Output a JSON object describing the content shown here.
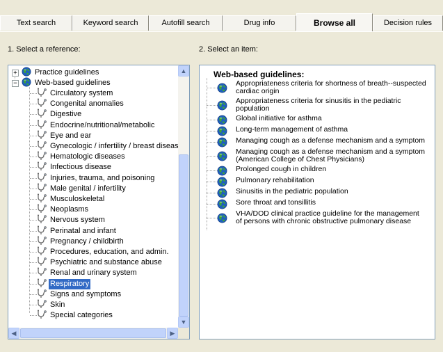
{
  "tabs": [
    {
      "label": "Text search",
      "active": false
    },
    {
      "label": "Keyword search",
      "active": false
    },
    {
      "label": "Autofill search",
      "active": false
    },
    {
      "label": "Drug info",
      "active": false
    },
    {
      "label": "Browse all",
      "active": true
    },
    {
      "label": "Decision rules",
      "active": false
    }
  ],
  "reference_label": "1. Select a reference:",
  "item_label": "2. Select an item:",
  "tree": {
    "practice": {
      "label": "Practice guidelines",
      "toggle": "+"
    },
    "web": {
      "label": "Web-based guidelines",
      "toggle": "−"
    },
    "children": [
      "Circulatory system",
      "Congenital anomalies",
      "Digestive",
      "Endocrine/nutritional/metabolic",
      "Eye and ear",
      "Gynecologic / infertility / breast disease",
      "Hematologic diseases",
      "Infectious disease",
      "Injuries, trauma, and poisoning",
      "Male genital / infertility",
      "Musculoskeletal",
      "Neoplasms",
      "Nervous system",
      "Perinatal and infant",
      "Pregnancy / childbirth",
      "Procedures, education, and admin.",
      "Psychiatric and substance abuse",
      "Renal and urinary system",
      "Respiratory",
      "Signs and symptoms",
      "Skin",
      "Special categories"
    ],
    "selected": "Respiratory"
  },
  "items": {
    "header": "Web-based guidelines:",
    "list": [
      {
        "lines": [
          "Appropriateness criteria for shortness of breath--suspected",
          "cardiac origin"
        ]
      },
      {
        "lines": [
          "Appropriateness criteria for sinusitis in the pediatric",
          "population"
        ]
      },
      {
        "lines": [
          "Global initiative for asthma"
        ]
      },
      {
        "lines": [
          "Long-term management of asthma"
        ]
      },
      {
        "lines": [
          "Managing cough as a defense mechanism and a symptom"
        ]
      },
      {
        "lines": [
          "Managing cough as a defense mechanism and a symptom",
          "(American College of Chest Physicians)"
        ]
      },
      {
        "lines": [
          "Prolonged cough in children"
        ]
      },
      {
        "lines": [
          "Pulmonary rehabilitation"
        ]
      },
      {
        "lines": [
          "Sinusitis in the pediatric population"
        ]
      },
      {
        "lines": [
          "Sore throat and tonsillitis"
        ]
      },
      {
        "lines": [
          "VHA/DOD clinical practice guideline for the management",
          "of persons with chronic obstructive pulmonary disease"
        ]
      }
    ]
  },
  "icons": {
    "tree_icon": "stethoscope-icon",
    "item_icon": "globe-icon",
    "scroll_up": "▲",
    "scroll_down": "▼",
    "scroll_left": "◀",
    "scroll_right": "▶"
  },
  "colors": {
    "selection": "#316ac5",
    "panel_border": "#7f9db9",
    "background": "#ece9d8"
  }
}
